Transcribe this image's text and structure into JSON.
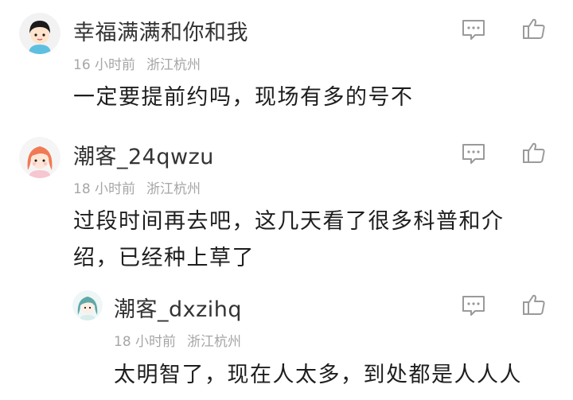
{
  "comments": [
    {
      "username": "幸福满满和你和我",
      "time": "16 小时前",
      "location": "浙江杭州",
      "text": "一定要提前约吗，现场有多的号不",
      "avatar_icon": "boy-avatar-icon"
    },
    {
      "username": "潮客_24qwzu",
      "time": "18 小时前",
      "location": "浙江杭州",
      "text": "过段时间再去吧，这几天看了很多科普和介绍，已经种上草了",
      "avatar_icon": "girl-avatar-icon"
    }
  ],
  "reply": {
    "username": "潮客_dxzihq",
    "time": "18 小时前",
    "location": "浙江杭州",
    "text": "太明智了，现在人太多，到处都是人人人",
    "avatar_icon": "girl-teal-avatar-icon"
  },
  "icons": {
    "comment": "comment-icon",
    "like": "thumbs-up-icon"
  },
  "colors": {
    "username": "#333333",
    "meta": "#a6a6a6",
    "icon": "#9a9a9a",
    "text": "#1e1e1e"
  }
}
